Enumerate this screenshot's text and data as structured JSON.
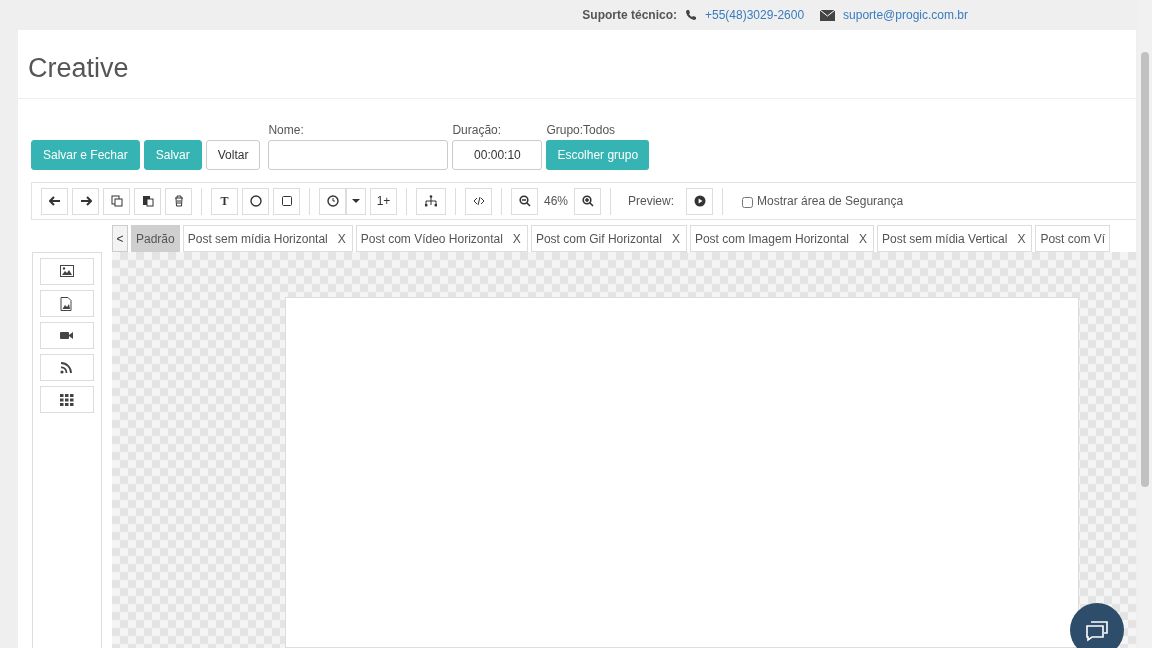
{
  "support": {
    "label": "Suporte técnico:",
    "phone": "+55(48)3029-2600",
    "email": "suporte@progic.com.br"
  },
  "title": "Creative",
  "actions": [
    {
      "label": "Salvar e Fechar",
      "kind": "primary"
    },
    {
      "label": "Salvar",
      "kind": "primary"
    },
    {
      "label": "Voltar",
      "kind": "default"
    }
  ],
  "name_field": {
    "label": "Nome:"
  },
  "duration_field": {
    "label": "Duração:",
    "value": "00:00:10"
  },
  "group": {
    "label": "Grupo:Todos",
    "button": "Escolher grupo"
  },
  "toolbar": {
    "text_tool": "T",
    "layer_button": "1+",
    "zoom": "46%",
    "preview_label": "Preview:",
    "safe_area": {
      "label": "Mostrar área de Segurança",
      "checked": false
    }
  },
  "tabs_back": "<",
  "tabs": [
    {
      "label": "Padrão",
      "selected": true,
      "closable": false
    },
    {
      "label": "Post sem mídia Horizontal",
      "selected": false,
      "closable": true,
      "close": "X"
    },
    {
      "label": "Post com Vídeo Horizontal",
      "selected": false,
      "closable": true,
      "close": "X"
    },
    {
      "label": "Post com Gif Horizontal",
      "selected": false,
      "closable": true,
      "close": "X"
    },
    {
      "label": "Post com Imagem Horizontal",
      "selected": false,
      "closable": true,
      "close": "X"
    },
    {
      "label": "Post sem mídia Vertical",
      "selected": false,
      "closable": true,
      "close": "X"
    },
    {
      "label": "Post com Ví",
      "selected": false,
      "closable": false
    }
  ]
}
